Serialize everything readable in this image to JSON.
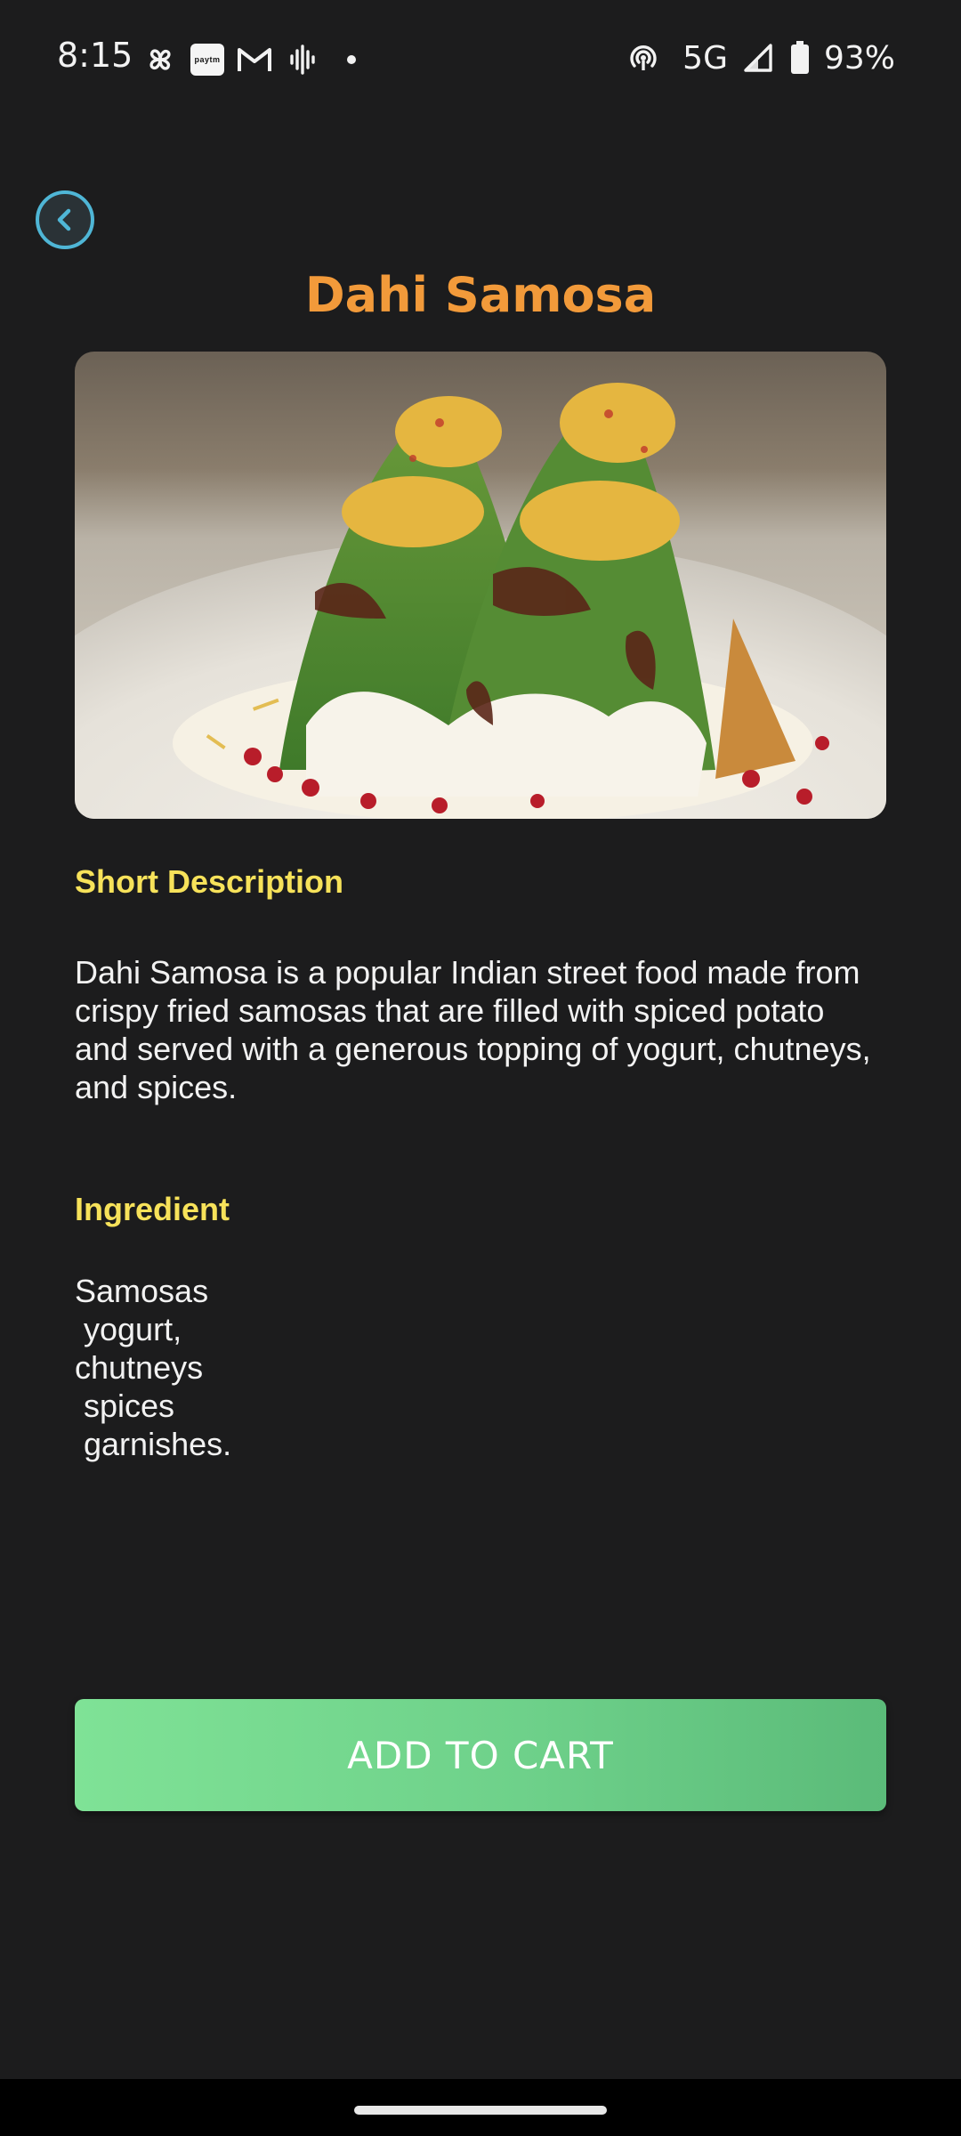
{
  "status_bar": {
    "time": "8:15",
    "left_icons": [
      "pinwheel-icon",
      "paytm-icon",
      "gmail-icon",
      "audio-wave-icon",
      "notification-dot-icon"
    ],
    "paytm_label": "paytm",
    "network": "5G",
    "battery": "93%",
    "right_icons": [
      "hotspot-icon",
      "signal-icon",
      "battery-icon"
    ]
  },
  "header": {
    "back_icon": "chevron-left-icon",
    "title": "Dahi Samosa"
  },
  "product": {
    "image": "dahi-samosa-photo",
    "description_heading": "Short Description",
    "description": "Dahi Samosa is a popular Indian street food made from crispy fried samosas that are filled with spiced potato and served with a generous topping of yogurt, chutneys, and spices.",
    "ingredient_heading": "Ingredient",
    "ingredients": "Samosas\n yogurt,\nchutneys\n spices\n garnishes."
  },
  "actions": {
    "add_to_cart_label": "ADD TO CART"
  },
  "colors": {
    "background": "#1c1c1d",
    "title": "#f29a3a",
    "heading": "#f7e25a",
    "back_ring": "#4fb6d6",
    "button_gradient_start": "#7fe296",
    "button_gradient_end": "#5bbb79"
  }
}
